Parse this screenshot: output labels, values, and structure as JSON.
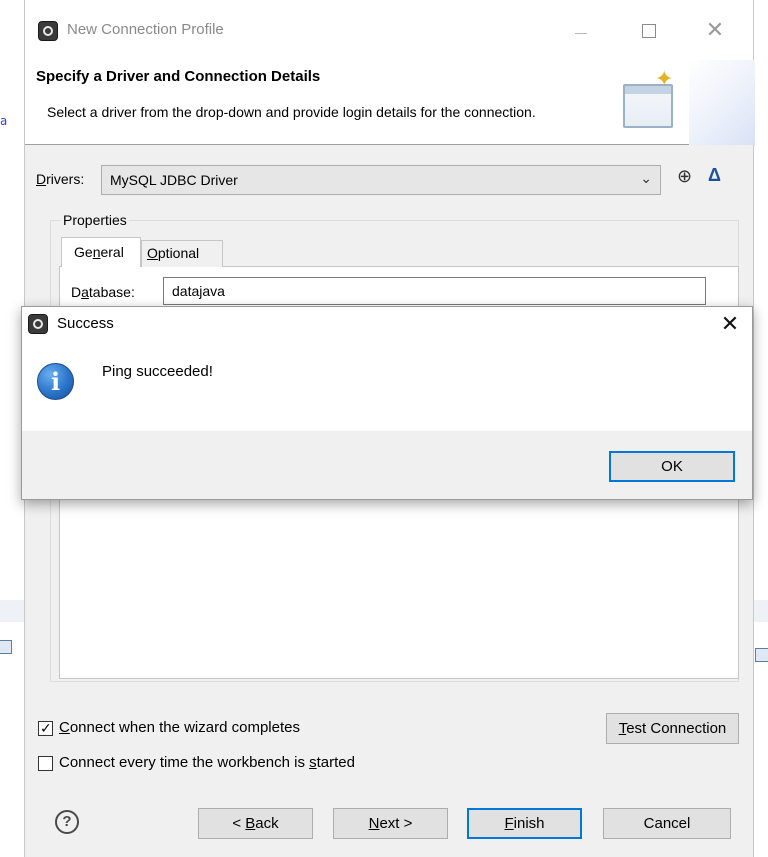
{
  "wizard": {
    "title": "New Connection Profile",
    "header_title": "Specify a Driver and Connection Details",
    "header_description": "Select a driver from the drop-down and provide login details for the connection.",
    "drivers": {
      "label_prefix": "D",
      "label_rest": "rivers:",
      "selected": "MySQL JDBC Driver"
    },
    "properties": {
      "legend": "Properties",
      "tabs": [
        {
          "pre": "Ge",
          "ul": "n",
          "post": "eral",
          "active": true
        },
        {
          "pre": "",
          "ul": "O",
          "post": "ptional",
          "active": false
        }
      ],
      "database_label_pre": "D",
      "database_label_ul": "a",
      "database_label_post": "tabase:",
      "database_value": "datajava"
    },
    "connect_when_completes": {
      "ul": "C",
      "rest": "onnect when the wizard completes",
      "checked": true
    },
    "connect_every_time": {
      "pre": "Connect every time the workbench is ",
      "ul": "s",
      "post": "tarted",
      "checked": false
    },
    "buttons": {
      "test": {
        "ul": "T",
        "rest": "est Connection"
      },
      "back": {
        "pre": "< ",
        "ul": "B",
        "post": "ack"
      },
      "next": {
        "ul": "N",
        "post": "ext >"
      },
      "finish": {
        "ul": "F",
        "post": "inish"
      },
      "cancel": "Cancel"
    },
    "help": "?"
  },
  "message_box": {
    "title": "Success",
    "message": "Ping succeeded!",
    "ok": "OK"
  },
  "background": {
    "left_text": "al"
  },
  "colors": {
    "accent": "#0078d7",
    "dialog_bg": "#f0f0f0",
    "info_blue": "#2a74c9"
  }
}
